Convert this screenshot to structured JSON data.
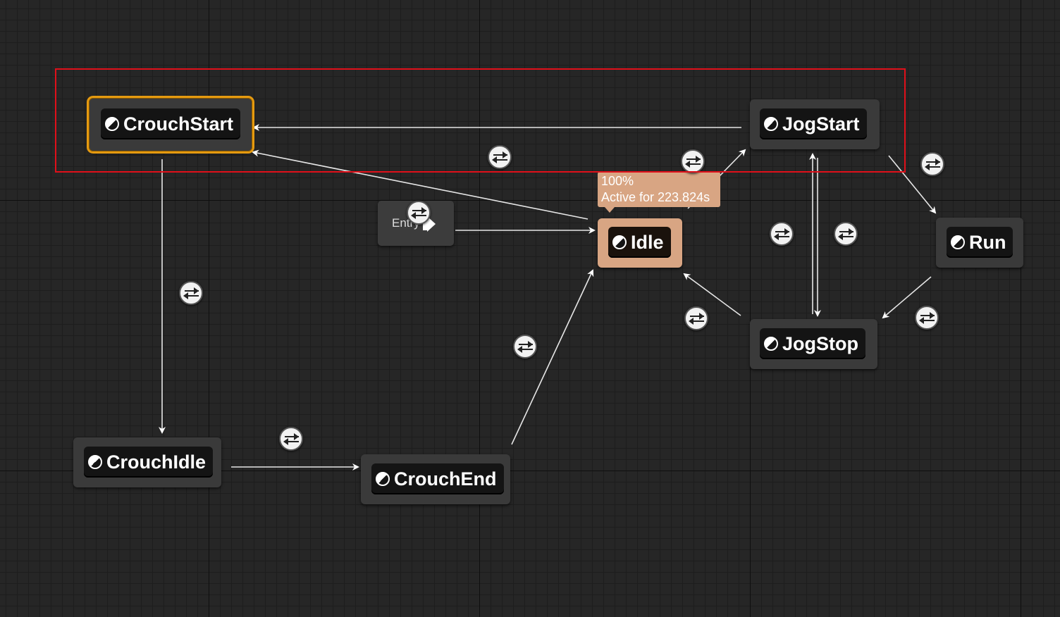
{
  "graph": {
    "entry_label": "Entry",
    "states": {
      "crouch_start": "CrouchStart",
      "jog_start": "JogStart",
      "idle": "Idle",
      "run": "Run",
      "jog_stop": "JogStop",
      "crouch_idle": "CrouchIdle",
      "crouch_end": "CrouchEnd"
    },
    "active_state_tooltip": {
      "weight": "100%",
      "active_time": "Active for 223.824s"
    }
  },
  "colors": {
    "selected_outline": "#e59a10",
    "active_state": "#d8a583",
    "highlight_box": "#e0101a"
  }
}
